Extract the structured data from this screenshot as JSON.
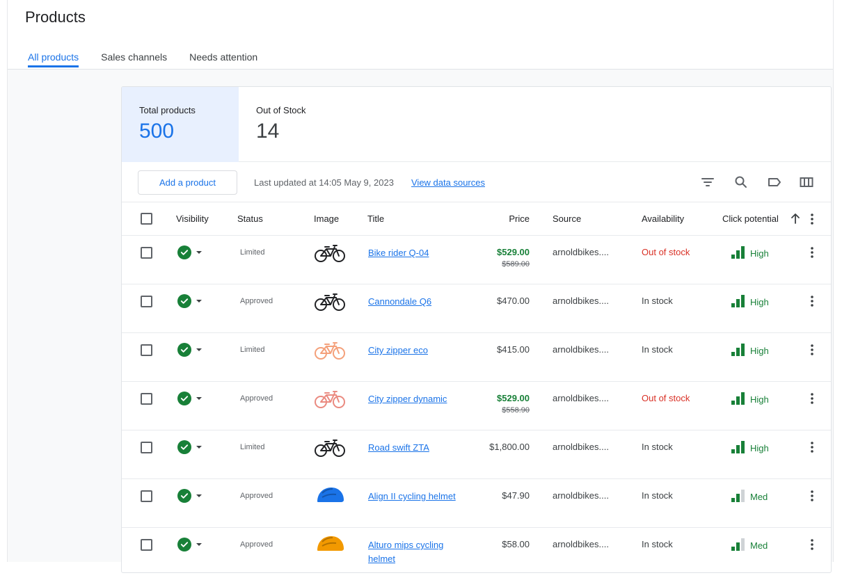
{
  "page": {
    "title": "Products"
  },
  "tabs": [
    {
      "label": "All products",
      "active": true
    },
    {
      "label": "Sales channels",
      "active": false
    },
    {
      "label": "Needs attention",
      "active": false
    }
  ],
  "stats": {
    "total_label": "Total products",
    "total_value": "500",
    "oos_label": "Out of Stock",
    "oos_value": "14"
  },
  "toolbar": {
    "add_label": "Add a product",
    "updated_text": "Last updated at 14:05 May 9, 2023",
    "view_link": "View data sources",
    "icons": [
      "filter-icon",
      "search-icon",
      "label-icon",
      "columns-icon"
    ]
  },
  "columns": {
    "visibility": "Visibility",
    "status": "Status",
    "image": "Image",
    "title": "Title",
    "price": "Price",
    "source": "Source",
    "availability": "Availability",
    "click_potential": "Click potential"
  },
  "colors": {
    "accent": "#1a73e8",
    "green": "#188038",
    "red": "#d93025"
  },
  "rows": [
    {
      "status": "Limited",
      "image": "bike-black-icon",
      "title": "Bike rider Q-04",
      "price": "$529.00",
      "old_price": "$589.00",
      "sale": true,
      "source": "arnoldbikes....",
      "availability": "Out of stock",
      "potential": "High",
      "level": 3
    },
    {
      "status": "Approved",
      "image": "bike-black-icon",
      "title": "Cannondale Q6",
      "price": "$470.00",
      "old_price": "",
      "sale": false,
      "source": "arnoldbikes....",
      "availability": "In stock",
      "potential": "High",
      "level": 3
    },
    {
      "status": "Limited",
      "image": "bike-orange-icon",
      "title": "City zipper eco",
      "price": "$415.00",
      "old_price": "",
      "sale": false,
      "source": "arnoldbikes....",
      "availability": "In stock",
      "potential": "High",
      "level": 3
    },
    {
      "status": "Approved",
      "image": "bike-red-icon",
      "title": "City zipper dynamic",
      "price": "$529.00",
      "old_price": "$558.90",
      "sale": true,
      "source": "arnoldbikes....",
      "availability": "Out of stock",
      "potential": "High",
      "level": 3
    },
    {
      "status": "Limited",
      "image": "bike-yellow-icon",
      "title": "Road swift ZTA",
      "price": "$1,800.00",
      "old_price": "",
      "sale": false,
      "source": "arnoldbikes....",
      "availability": "In stock",
      "potential": "High",
      "level": 3
    },
    {
      "status": "Approved",
      "image": "helmet-blue-icon",
      "title": "Align II cycling helmet",
      "price": "$47.90",
      "old_price": "",
      "sale": false,
      "source": "arnoldbikes....",
      "availability": "In stock",
      "potential": "Med",
      "level": 2
    },
    {
      "status": "Approved",
      "image": "helmet-orange-icon",
      "title": "Alturo mips cycling helmet",
      "price": "$58.00",
      "old_price": "",
      "sale": false,
      "source": "arnoldbikes....",
      "availability": "In stock",
      "potential": "Med",
      "level": 2
    }
  ]
}
